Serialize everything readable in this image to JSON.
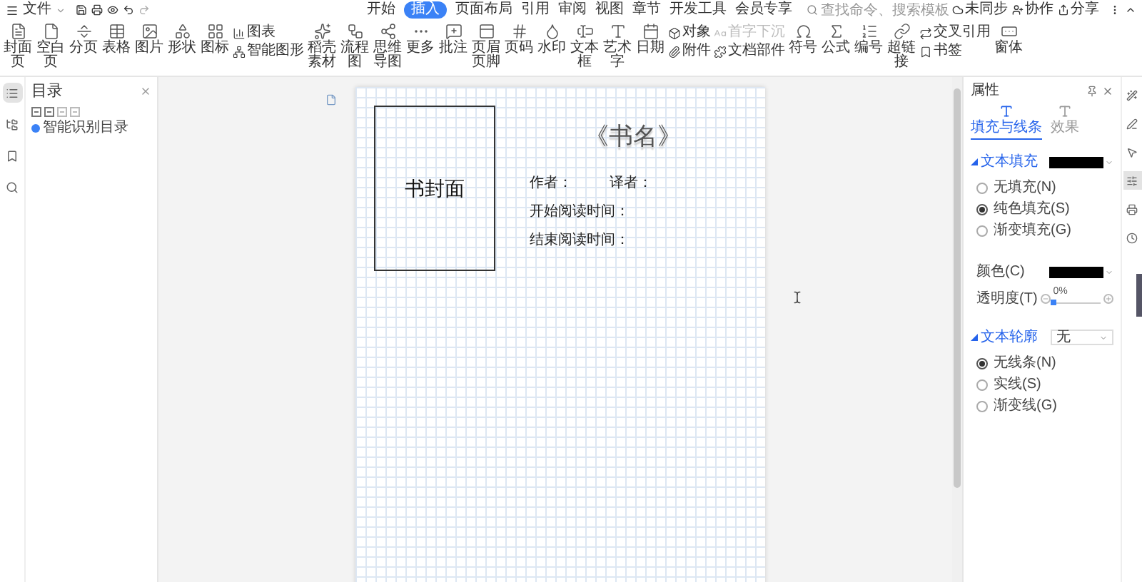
{
  "menu_bar": {
    "file_menu": "文件",
    "tabs": [
      {
        "label": "开始",
        "selected": false
      },
      {
        "label": "插入",
        "selected": true
      },
      {
        "label": "页面布局",
        "selected": false
      },
      {
        "label": "引用",
        "selected": false
      },
      {
        "label": "审阅",
        "selected": false
      },
      {
        "label": "视图",
        "selected": false
      },
      {
        "label": "章节",
        "selected": false
      },
      {
        "label": "开发工具",
        "selected": false
      },
      {
        "label": "会员专享",
        "selected": false
      }
    ],
    "search": {
      "placeholder": "查找命令、搜索模板"
    },
    "actions": [
      "未同步",
      "协作",
      "分享"
    ]
  },
  "ribbon": {
    "items": [
      {
        "kind": "big",
        "label": "封面页"
      },
      {
        "kind": "big",
        "label": "空白页"
      },
      {
        "kind": "big",
        "label": "分页"
      },
      {
        "kind": "big",
        "label": "表格"
      },
      {
        "kind": "big",
        "label": "图片"
      },
      {
        "kind": "big",
        "label": "形状"
      },
      {
        "kind": "big",
        "label": "图标"
      },
      {
        "kind": "stack",
        "entries": [
          {
            "label": "图表",
            "disabled": false
          },
          {
            "label": "智能图形",
            "disabled": false
          }
        ]
      },
      {
        "kind": "big",
        "label": "稻壳素材"
      },
      {
        "kind": "big",
        "label": "流程图"
      },
      {
        "kind": "big",
        "label": "思维导图"
      },
      {
        "kind": "big",
        "label": "更多"
      },
      {
        "kind": "big",
        "label": "批注"
      },
      {
        "kind": "big",
        "label": "页眉页脚"
      },
      {
        "kind": "big",
        "label": "页码"
      },
      {
        "kind": "big",
        "label": "水印"
      },
      {
        "kind": "big",
        "label": "文本框"
      },
      {
        "kind": "big",
        "label": "艺术字"
      },
      {
        "kind": "big",
        "label": "日期"
      },
      {
        "kind": "stack",
        "entries": [
          {
            "label": "对象",
            "disabled": false
          },
          {
            "label": "附件",
            "disabled": false
          }
        ]
      },
      {
        "kind": "stack",
        "entries": [
          {
            "label": "首字下沉",
            "disabled": true
          },
          {
            "label": "文档部件",
            "disabled": false
          }
        ]
      },
      {
        "kind": "big",
        "label": "符号"
      },
      {
        "kind": "big",
        "label": "公式"
      },
      {
        "kind": "big",
        "label": "编号"
      },
      {
        "kind": "big",
        "label": "超链接"
      },
      {
        "kind": "stack",
        "entries": [
          {
            "label": "交叉引用",
            "disabled": false
          },
          {
            "label": "书签",
            "disabled": false
          }
        ]
      },
      {
        "kind": "big",
        "label": "窗体"
      }
    ]
  },
  "left_rail": [
    {
      "selected": true
    },
    {
      "selected": false
    },
    {
      "selected": false
    },
    {
      "selected": false
    }
  ],
  "navigation_pane": {
    "title": "目录",
    "button": "智能识别目录"
  },
  "document": {
    "cover": "书封面",
    "title": "《书名》",
    "fields": [
      {
        "labels": [
          "作者：",
          "译者："
        ]
      },
      {
        "labels": [
          "开始阅读时间："
        ]
      },
      {
        "labels": [
          "结束阅读时间："
        ]
      }
    ]
  },
  "properties_pane": {
    "title": "属性",
    "tabs": [
      {
        "label": "填充与线条",
        "selected": true
      },
      {
        "label": "效果",
        "selected": false
      }
    ],
    "text_fill": {
      "title": "文本填充",
      "options": [
        {
          "label": "无填充(N)",
          "selected": false
        },
        {
          "label": "纯色填充(S)",
          "selected": true
        },
        {
          "label": "渐变填充(G)",
          "selected": false
        }
      ],
      "color_label": "颜色(C)",
      "transparency_label": "透明度(T)",
      "transparency": {
        "level": 0,
        "reading": "0%"
      }
    },
    "text_outline": {
      "title": "文本轮廓",
      "value": "无",
      "options": [
        {
          "label": "无线条(N)",
          "selected": true
        },
        {
          "label": "实线(S)",
          "selected": false
        },
        {
          "label": "渐变线(G)",
          "selected": false
        }
      ]
    }
  },
  "right_rail": [
    {
      "selected": false
    },
    {
      "selected": false
    },
    {
      "selected": false
    },
    {
      "selected": true
    },
    {
      "selected": false
    },
    {
      "selected": false
    }
  ]
}
